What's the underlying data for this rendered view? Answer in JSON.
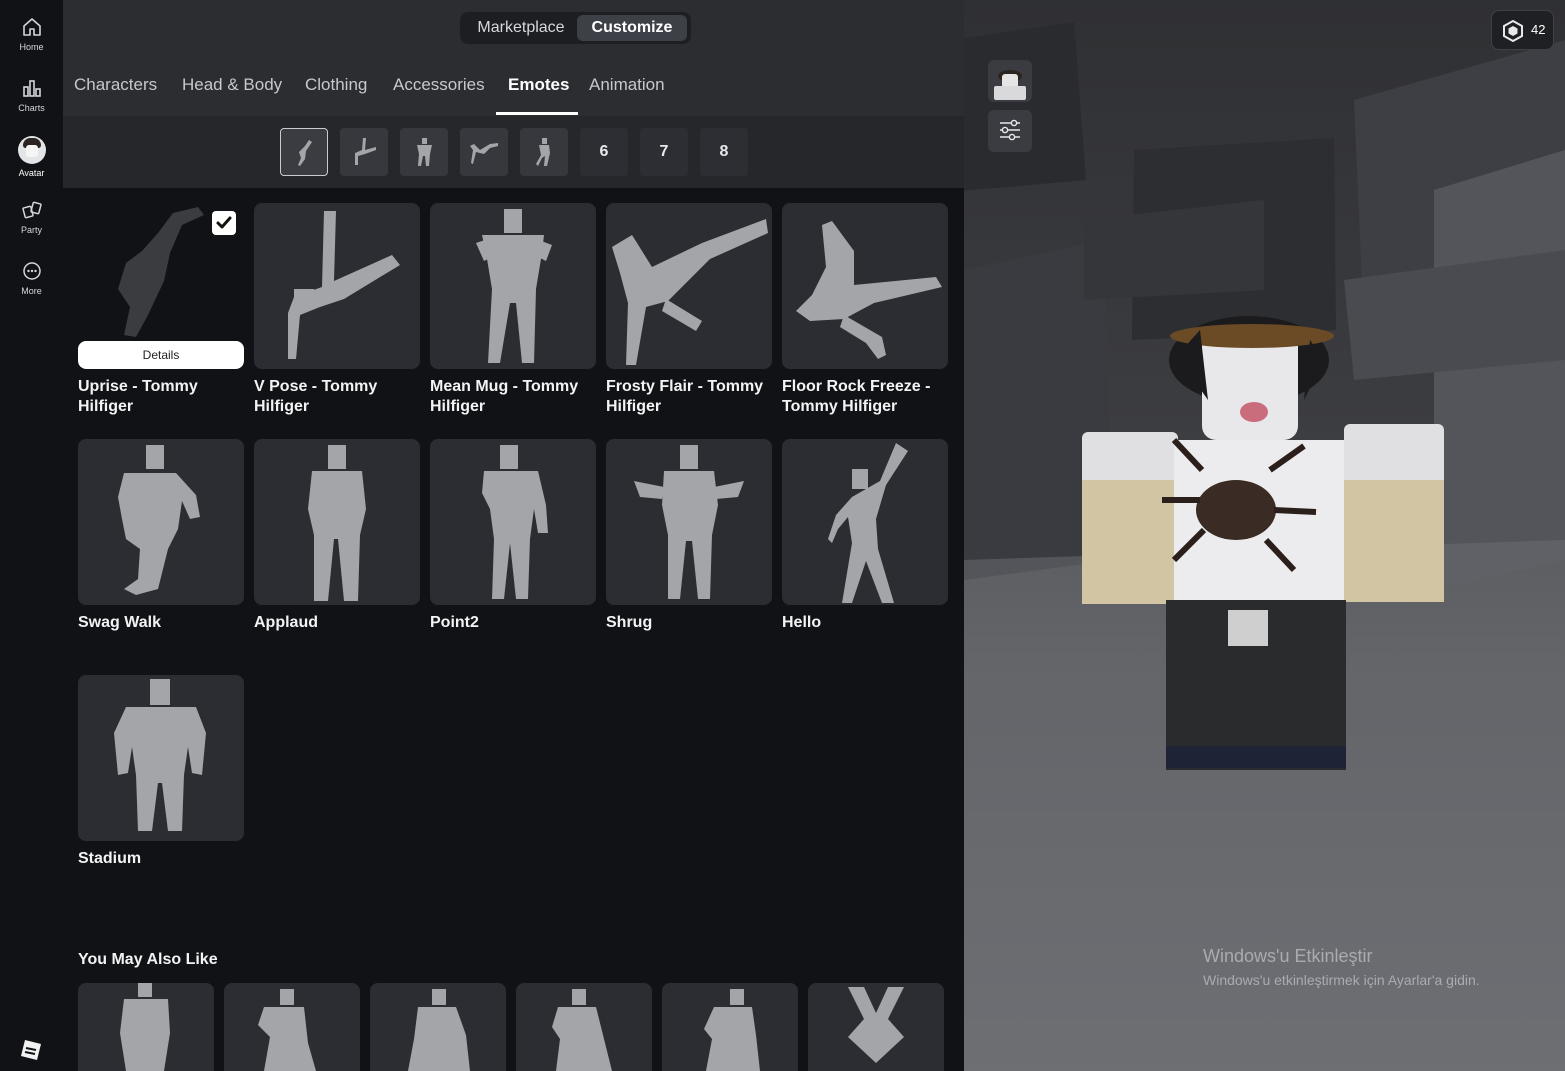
{
  "sidebar": {
    "items": [
      {
        "label": "Home",
        "icon": "home-icon"
      },
      {
        "label": "Charts",
        "icon": "charts-icon"
      },
      {
        "label": "Avatar",
        "icon": "avatar-icon"
      },
      {
        "label": "Party",
        "icon": "party-icon"
      },
      {
        "label": "More",
        "icon": "more-icon"
      }
    ],
    "logo_icon": "roblox-logo-icon"
  },
  "topbar": {
    "segments": [
      {
        "label": "Marketplace",
        "active": false
      },
      {
        "label": "Customize",
        "active": true
      }
    ]
  },
  "tabs": [
    {
      "label": "Characters"
    },
    {
      "label": "Head & Body"
    },
    {
      "label": "Clothing"
    },
    {
      "label": "Accessories"
    },
    {
      "label": "Emotes",
      "active": true
    },
    {
      "label": "Animation"
    }
  ],
  "slots": {
    "icon_slots": [
      "slot-1-emote-icon",
      "slot-2-emote-icon",
      "slot-3-emote-icon",
      "slot-4-emote-icon",
      "slot-5-emote-icon"
    ],
    "numbers": [
      "6",
      "7",
      "8"
    ]
  },
  "items": [
    {
      "name": "Uprise - Tommy Hilfiger",
      "equipped": true,
      "details_label": "Details"
    },
    {
      "name": "V Pose - Tommy Hilfiger"
    },
    {
      "name": "Mean Mug - Tommy Hilfiger"
    },
    {
      "name": "Frosty Flair - Tommy Hilfiger"
    },
    {
      "name": "Floor Rock Freeze - Tommy Hilfiger"
    },
    {
      "name": "Swag Walk"
    },
    {
      "name": "Applaud"
    },
    {
      "name": "Point2"
    },
    {
      "name": "Shrug"
    },
    {
      "name": "Hello"
    },
    {
      "name": "Stadium"
    }
  ],
  "recommendations": {
    "title": "You May Also Like",
    "count_visible": 6
  },
  "viewer": {
    "robux_balance": "42",
    "buttons": [
      "avatar-thumbnail-button",
      "settings-sliders-icon"
    ]
  },
  "watermark": {
    "line1": "Windows'u Etkinleştir",
    "line2": "Windows'u etkinleştirmek için Ayarlar'a gidin."
  },
  "colors": {
    "sidebar_bg": "#111216",
    "header_bg": "#2b2d31",
    "card_bg": "#2c2d33",
    "accent": "#ffffff"
  }
}
